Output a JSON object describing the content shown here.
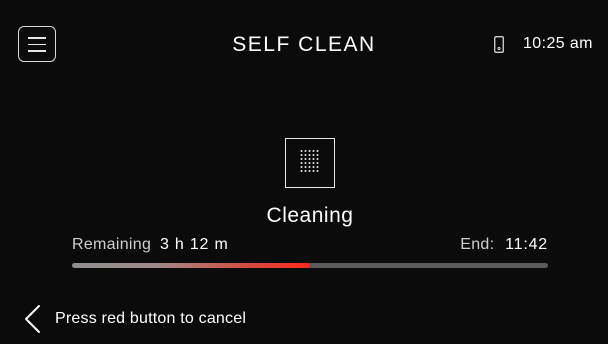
{
  "header": {
    "title": "SELF CLEAN",
    "time": "10:25 am",
    "menu_icon": "hamburger-menu-icon",
    "device_icon": "phone-icon"
  },
  "mode": {
    "icon": "self-clean-dots-icon",
    "status": "Cleaning"
  },
  "timer": {
    "remaining_label": "Remaining",
    "remaining_value": "3 h 12 m",
    "end_label": "End:",
    "end_value": "11:42",
    "progress": 0.5
  },
  "footer": {
    "back_icon": "chevron-left-icon",
    "hint": "Press red button to cancel"
  },
  "colors": {
    "background": "#0b0b0b",
    "text": "#ffffff",
    "progress_track": "#5a5a5a",
    "progress_accent": "#ff2a1a"
  }
}
